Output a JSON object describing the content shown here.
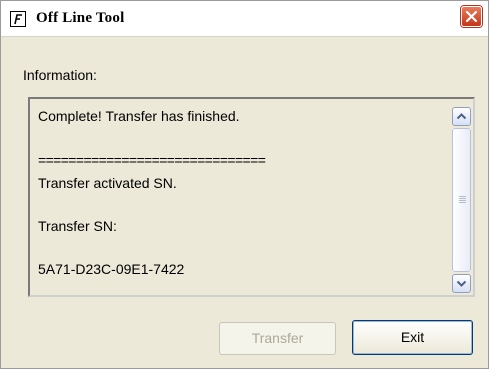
{
  "window": {
    "title": "Off Line Tool",
    "close_icon": "close-icon",
    "app_icon": "app-icon"
  },
  "info": {
    "label": "Information:",
    "lines": [
      "Complete! Transfer has finished.",
      "==============================",
      "Transfer activated SN.",
      "Transfer SN:",
      "5A71-D23C-09E1-7422"
    ]
  },
  "scrollbar": {
    "up_icon": "scroll-up-arrow-icon",
    "down_icon": "scroll-down-arrow-icon"
  },
  "buttons": {
    "transfer_label": "Transfer",
    "transfer_enabled": false,
    "exit_label": "Exit"
  },
  "colors": {
    "dialog_background": "#ECE9D8",
    "close_button": "#D6482B",
    "default_button_border": "#003C74",
    "disabled_text": "#ACA899"
  }
}
